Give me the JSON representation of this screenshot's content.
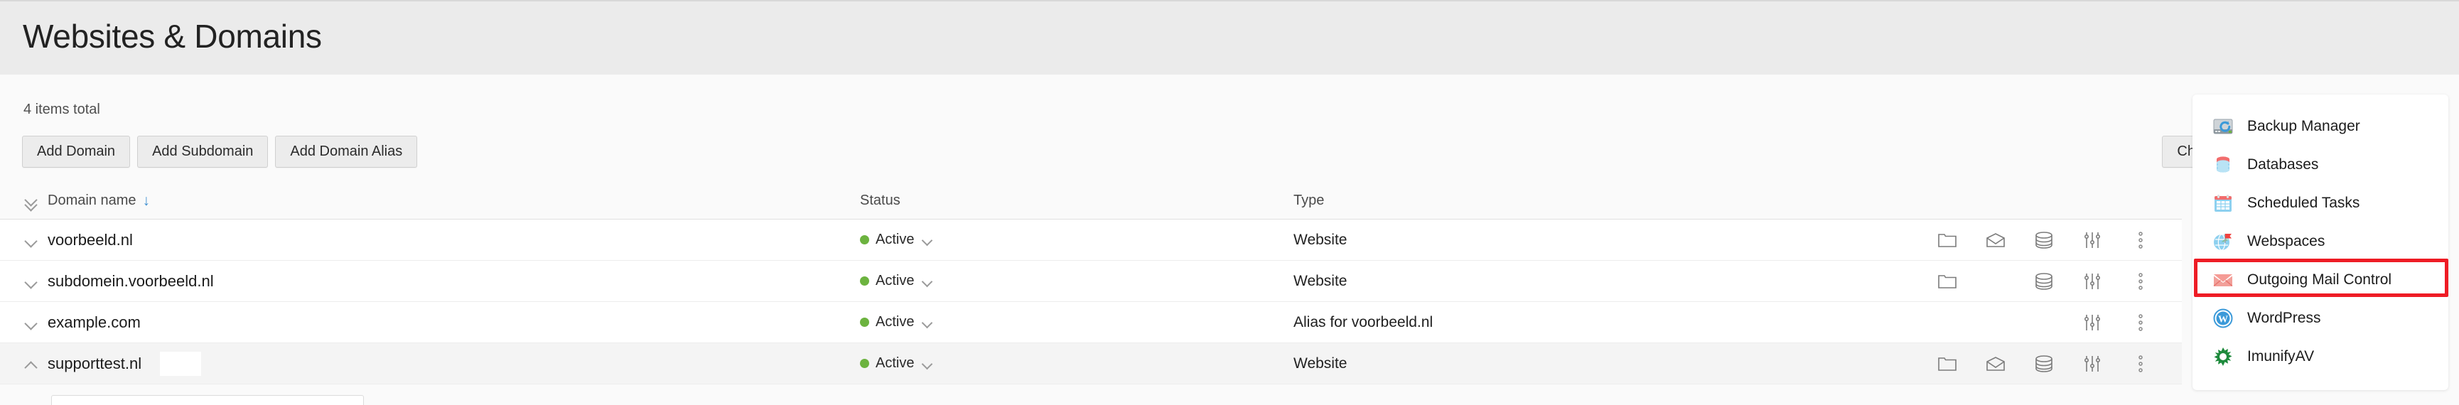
{
  "header": {
    "title": "Websites & Domains"
  },
  "summary": {
    "items_total": "4 items total"
  },
  "toolbar": {
    "add_domain": "Add Domain",
    "add_subdomain": "Add Subdomain",
    "add_domain_alias": "Add Domain Alias",
    "change_view": "Change view"
  },
  "table": {
    "columns": {
      "domain_name": "Domain name",
      "status": "Status",
      "type": "Type"
    },
    "sort_indicator": "↓",
    "rows": [
      {
        "name": "voorbeeld.nl",
        "status": "Active",
        "type": "Website",
        "expanded": false,
        "redacted": false,
        "actions": [
          "folder-icon",
          "mail-icon",
          "database-icon",
          "settings-sliders-icon",
          "more-vertical-icon"
        ]
      },
      {
        "name": "subdomein.voorbeeld.nl",
        "status": "Active",
        "type": "Website",
        "expanded": false,
        "redacted": false,
        "actions": [
          "folder-icon",
          "database-icon",
          "settings-sliders-icon",
          "more-vertical-icon"
        ]
      },
      {
        "name": "example.com",
        "status": "Active",
        "type": "Alias for voorbeeld.nl",
        "expanded": false,
        "redacted": false,
        "actions": [
          "settings-sliders-icon",
          "more-vertical-icon"
        ]
      },
      {
        "name": "supporttest.nl",
        "status": "Active",
        "type": "Website",
        "expanded": true,
        "redacted": true,
        "actions": [
          "folder-icon",
          "mail-icon",
          "database-icon",
          "settings-sliders-icon",
          "more-vertical-icon"
        ]
      }
    ]
  },
  "side_panel": {
    "items": [
      {
        "label": "Backup Manager",
        "icon": "backup-manager-icon",
        "highlighted": false
      },
      {
        "label": "Databases",
        "icon": "databases-icon",
        "highlighted": false
      },
      {
        "label": "Scheduled Tasks",
        "icon": "scheduled-tasks-icon",
        "highlighted": false
      },
      {
        "label": "Webspaces",
        "icon": "webspaces-icon",
        "highlighted": false
      },
      {
        "label": "Outgoing Mail Control",
        "icon": "outgoing-mail-icon",
        "highlighted": true
      },
      {
        "label": "WordPress",
        "icon": "wordpress-icon",
        "highlighted": false
      },
      {
        "label": "ImunifyAV",
        "icon": "imunifyav-icon",
        "highlighted": false
      }
    ]
  },
  "colors": {
    "header_band": "#ebebeb",
    "page_bg": "#fafafa",
    "status_green": "#6cb33f",
    "sort_blue": "#3e8fd0",
    "highlight_red": "#ee1c25"
  }
}
